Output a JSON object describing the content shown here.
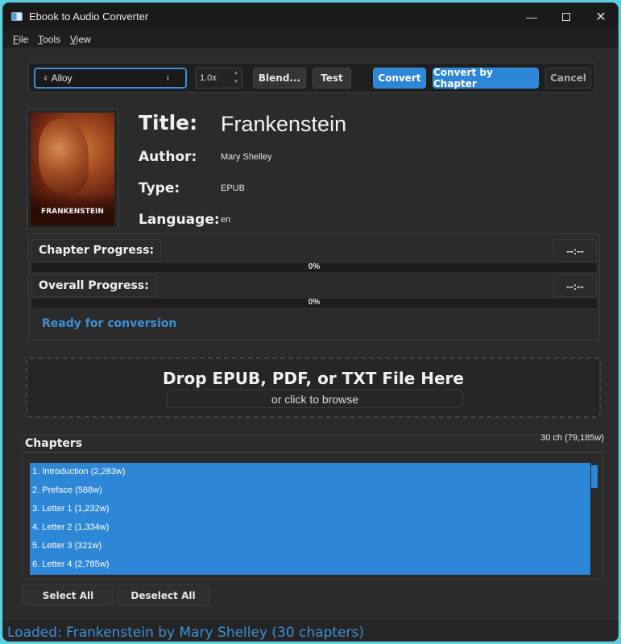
{
  "window": {
    "title": "Ebook to Audio Converter",
    "minimize": "—",
    "close": "✕"
  },
  "menu": {
    "items": [
      "File",
      "Tools",
      "View"
    ]
  },
  "toolbar": {
    "voice_value": "♀ Alloy",
    "speed_value": "1.0x",
    "blend_label": "Blend...",
    "test_label": "Test",
    "convert_label": "Convert",
    "convert_chapter_label": "Convert by Chapter",
    "cancel_label": "Cancel"
  },
  "book": {
    "cover_title": "FRANKENSTEIN",
    "title_label": "Title:",
    "title": "Frankenstein",
    "author_label": "Author:",
    "author": "Mary Shelley",
    "type_label": "Type:",
    "type": "EPUB",
    "language_label": "Language:",
    "language": "en"
  },
  "progress": {
    "chapter_label": "Chapter Progress:",
    "chapter_time": "--:--",
    "chapter_percent": "0%",
    "chapter_fraction": 0,
    "overall_label": "Overall Progress:",
    "overall_time": "--:--",
    "overall_percent": "0%",
    "overall_fraction": 0,
    "status": "Ready for conversion"
  },
  "dropzone": {
    "title": "Drop EPUB, PDF, or TXT File Here",
    "subtitle": "or click to browse"
  },
  "chapters": {
    "title": "Chapters",
    "count": "30 ch (79,185w)",
    "items": [
      "1. Introduction (2,283w)",
      "2. Preface (588w)",
      "3. Letter 1 (1,232w)",
      "4. Letter 2 (1,334w)",
      "5. Letter 3 (321w)",
      "6. Letter 4 (2,785w)"
    ],
    "select_all": "Select All",
    "deselect_all": "Deselect All"
  },
  "statusbar": {
    "text": "Loaded: Frankenstein by Mary Shelley (30 chapters)"
  },
  "colors": {
    "accent": "#2e86d6",
    "status_blue": "#3d8fd9",
    "background": "#2b2b2b"
  }
}
